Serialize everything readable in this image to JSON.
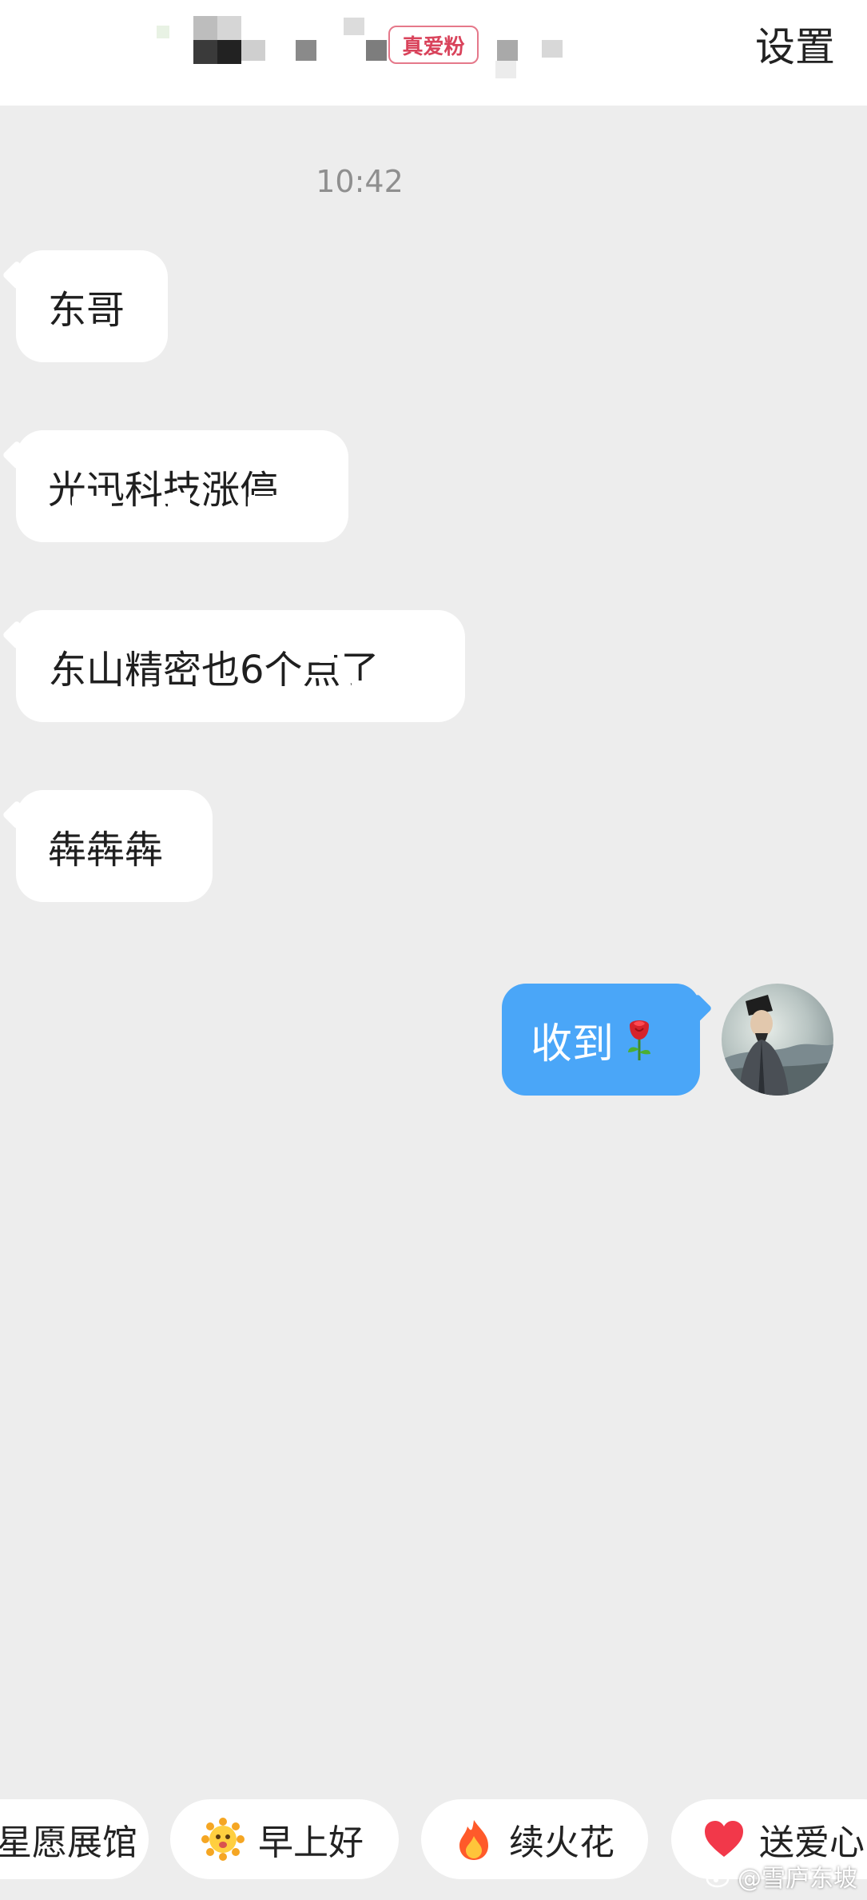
{
  "header": {
    "fan_badge": "真爱粉",
    "settings_label": "设置"
  },
  "chat": {
    "timestamp": "10:42",
    "incoming": [
      "东哥",
      "光迅科技涨停",
      "东山精密也6个点了",
      "犇犇犇"
    ],
    "outgoing": [
      {
        "text": "收到",
        "emoji": "rose-icon"
      }
    ]
  },
  "quick_replies": [
    {
      "label": "星愿展馆",
      "icon": ""
    },
    {
      "label": "早上好",
      "icon": "sun-face-icon"
    },
    {
      "label": "续火花",
      "icon": "fire-icon"
    },
    {
      "label": "送爱心",
      "icon": "heart-icon"
    }
  ],
  "watermark": "@雪庐东坡",
  "colors": {
    "background": "#ededed",
    "outgoing_bubble": "#4aa6f8",
    "badge": "#d9435b"
  }
}
